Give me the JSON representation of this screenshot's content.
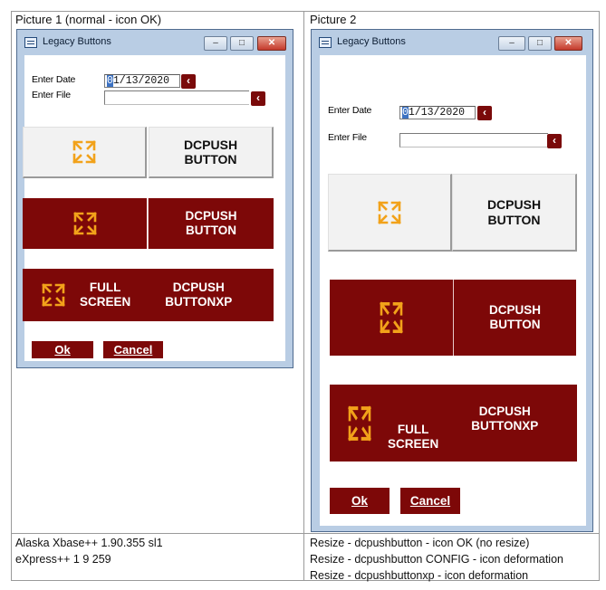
{
  "headings": {
    "picture1": "Picture 1 (normal - icon OK)",
    "picture2": "Picture 2"
  },
  "window": {
    "title": "Legacy Buttons",
    "minimize": "–",
    "maximize": "□",
    "close": "✕"
  },
  "form": {
    "date_label": "Enter Date",
    "date_cursor": "0",
    "date_rest": "1/13/2020",
    "file_label": "Enter File",
    "picker_glyph": "‹"
  },
  "buttons": {
    "dcpush_label": "DCPUSH\nBUTTON",
    "dcpushxp_label": "DCPUSH\nBUTTONXP",
    "fullscreen_label": "FULL\nSCREEN",
    "ok_label": "Ok",
    "cancel_label": "Cancel"
  },
  "icon": "fullscreen-expand-icon",
  "colors": {
    "dark_red": "#7d0808",
    "icon_orange": "#f2a21a",
    "window_frame": "#b9cde4"
  },
  "footer_left": [
    "Alaska Xbase++ 1.90.355 sl1",
    "eXpress++  1 9 259"
  ],
  "footer_right": [
    "Resize - dcpushbutton - icon OK (no resize)",
    "Resize - dcpushbutton CONFIG - icon deformation",
    "Resize - dcpushbuttonxp - icon deformation"
  ]
}
